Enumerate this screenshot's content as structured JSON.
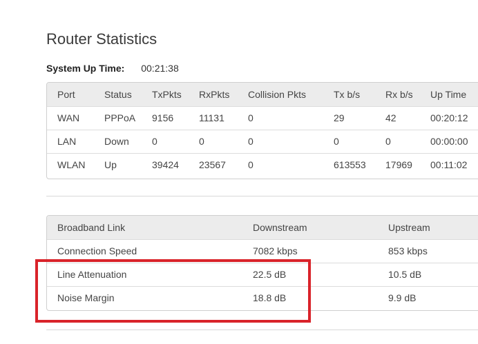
{
  "page": {
    "title": "Router Statistics",
    "uptime_label": "System Up Time:",
    "uptime_value": "00:21:38"
  },
  "stats_table": {
    "headers": [
      "Port",
      "Status",
      "TxPkts",
      "RxPkts",
      "Collision Pkts",
      "Tx b/s",
      "Rx b/s",
      "Up Time"
    ],
    "rows": [
      [
        "WAN",
        "PPPoA",
        "9156",
        "11131",
        "0",
        "29",
        "42",
        "00:20:12"
      ],
      [
        "LAN",
        "Down",
        "0",
        "0",
        "0",
        "0",
        "0",
        "00:00:00"
      ],
      [
        "WLAN",
        "Up",
        "39424",
        "23567",
        "0",
        "613553",
        "17969",
        "00:11:02"
      ]
    ]
  },
  "broadband_table": {
    "headers": [
      "Broadband Link",
      "Downstream",
      "Upstream"
    ],
    "rows": [
      [
        "Connection Speed",
        "7082 kbps",
        "853 kbps"
      ],
      [
        "Line Attenuation",
        "22.5 dB",
        "10.5 dB"
      ],
      [
        "Noise Margin",
        "18.8 dB",
        "9.9 dB"
      ]
    ]
  },
  "colors": {
    "highlight_border": "#d9232a",
    "header_bg": "#ececec"
  }
}
